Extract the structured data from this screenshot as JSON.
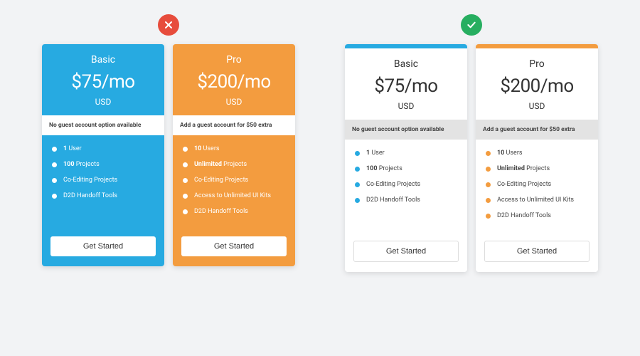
{
  "colors": {
    "blue": "#27aae1",
    "orange": "#f39c3f",
    "bad": "#e74c3c",
    "good": "#27ae60"
  },
  "bad": {
    "basic": {
      "name": "Basic",
      "price": "$75/mo",
      "currency": "USD",
      "note": "No guest account option available",
      "features": [
        {
          "bold": "1",
          "rest": " User"
        },
        {
          "bold": "100",
          "rest": " Projects"
        },
        {
          "bold": "",
          "rest": "Co-Editing Projects"
        },
        {
          "bold": "",
          "rest": "D2D Handoff Tools"
        }
      ],
      "cta": "Get Started"
    },
    "pro": {
      "name": "Pro",
      "price": "$200/mo",
      "currency": "USD",
      "note": "Add a guest account for $50 extra",
      "features": [
        {
          "bold": "10",
          "rest": " Users"
        },
        {
          "bold": "Unlimited",
          "rest": " Projects"
        },
        {
          "bold": "",
          "rest": "Co-Editing Projects"
        },
        {
          "bold": "",
          "rest": "Access to Unlimited UI Kits"
        },
        {
          "bold": "",
          "rest": "D2D Handoff Tools"
        }
      ],
      "cta": "Get Started"
    }
  },
  "good": {
    "basic": {
      "name": "Basic",
      "price": "$75/mo",
      "currency": "USD",
      "note": "No guest account option available",
      "features": [
        {
          "bold": "1",
          "rest": " User"
        },
        {
          "bold": "100",
          "rest": " Projects"
        },
        {
          "bold": "",
          "rest": "Co-Editing Projects"
        },
        {
          "bold": "",
          "rest": "D2D Handoff Tools"
        }
      ],
      "cta": "Get Started"
    },
    "pro": {
      "name": "Pro",
      "price": "$200/mo",
      "currency": "USD",
      "note": "Add a guest account for $50 extra",
      "features": [
        {
          "bold": "10",
          "rest": " Users"
        },
        {
          "bold": "Unlimited",
          "rest": " Projects"
        },
        {
          "bold": "",
          "rest": "Co-Editing Projects"
        },
        {
          "bold": "",
          "rest": "Access to Unlimited UI Kits"
        },
        {
          "bold": "",
          "rest": "D2D Handoff Tools"
        }
      ],
      "cta": "Get Started"
    }
  }
}
